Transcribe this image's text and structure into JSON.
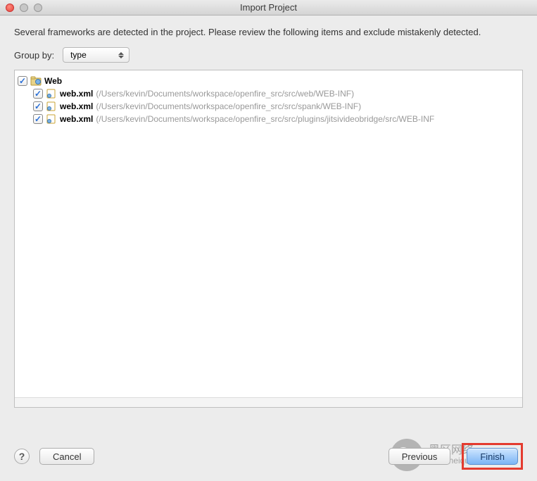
{
  "window": {
    "title": "Import Project"
  },
  "description": "Several frameworks are detected in the project. Please review the following items and exclude mistakenly detected.",
  "group": {
    "label": "Group by:",
    "selected": "type"
  },
  "tree": {
    "root": {
      "label": "Web"
    },
    "items": [
      {
        "name": "web.xml",
        "path": "(/Users/kevin/Documents/workspace/openfire_src/src/web/WEB-INF)"
      },
      {
        "name": "web.xml",
        "path": "(/Users/kevin/Documents/workspace/openfire_src/src/spank/WEB-INF)"
      },
      {
        "name": "web.xml",
        "path": "(/Users/kevin/Documents/workspace/openfire_src/src/plugins/jitsivideobridge/src/WEB-INF"
      }
    ]
  },
  "buttons": {
    "help": "?",
    "cancel": "Cancel",
    "previous": "Previous",
    "finish": "Finish"
  },
  "watermark": {
    "line1": "黑区网络",
    "line2": "www.heiqu.com"
  }
}
